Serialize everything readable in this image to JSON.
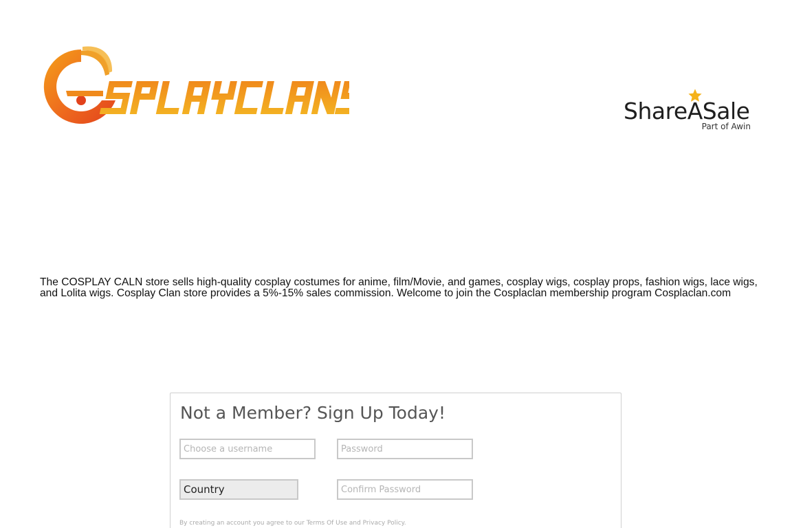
{
  "header": {
    "logo_text": "COSPLAYCLANS",
    "partner": {
      "name": "ShareASale",
      "tagline": "Part of Awin",
      "star_color": "#f5b21b"
    }
  },
  "description": "The COSPLAY CALN store sells high-quality cosplay costumes for anime, film/Movie, and games, cosplay wigs, cosplay props, fashion wigs, lace wigs, and Lolita wigs. Cosplay Clan store provides a 5%-15% sales commission. Welcome to join the Cosplaclan membership program Cosplaclan.com",
  "signup": {
    "title": "Not a Member? Sign Up Today!",
    "username_placeholder": "Choose a username",
    "password_placeholder": "Password",
    "country_value": "Country",
    "confirm_password_placeholder": "Confirm Password",
    "terms_prefix": "By creating an account you agree to our ",
    "terms_link": "Terms Of Use",
    "terms_and": " and ",
    "privacy_link": "Privacy Policy",
    "terms_suffix": "."
  },
  "colors": {
    "logo_orange": "#ee6a1e",
    "logo_amber": "#f4a019",
    "logo_red": "#e2421c"
  }
}
